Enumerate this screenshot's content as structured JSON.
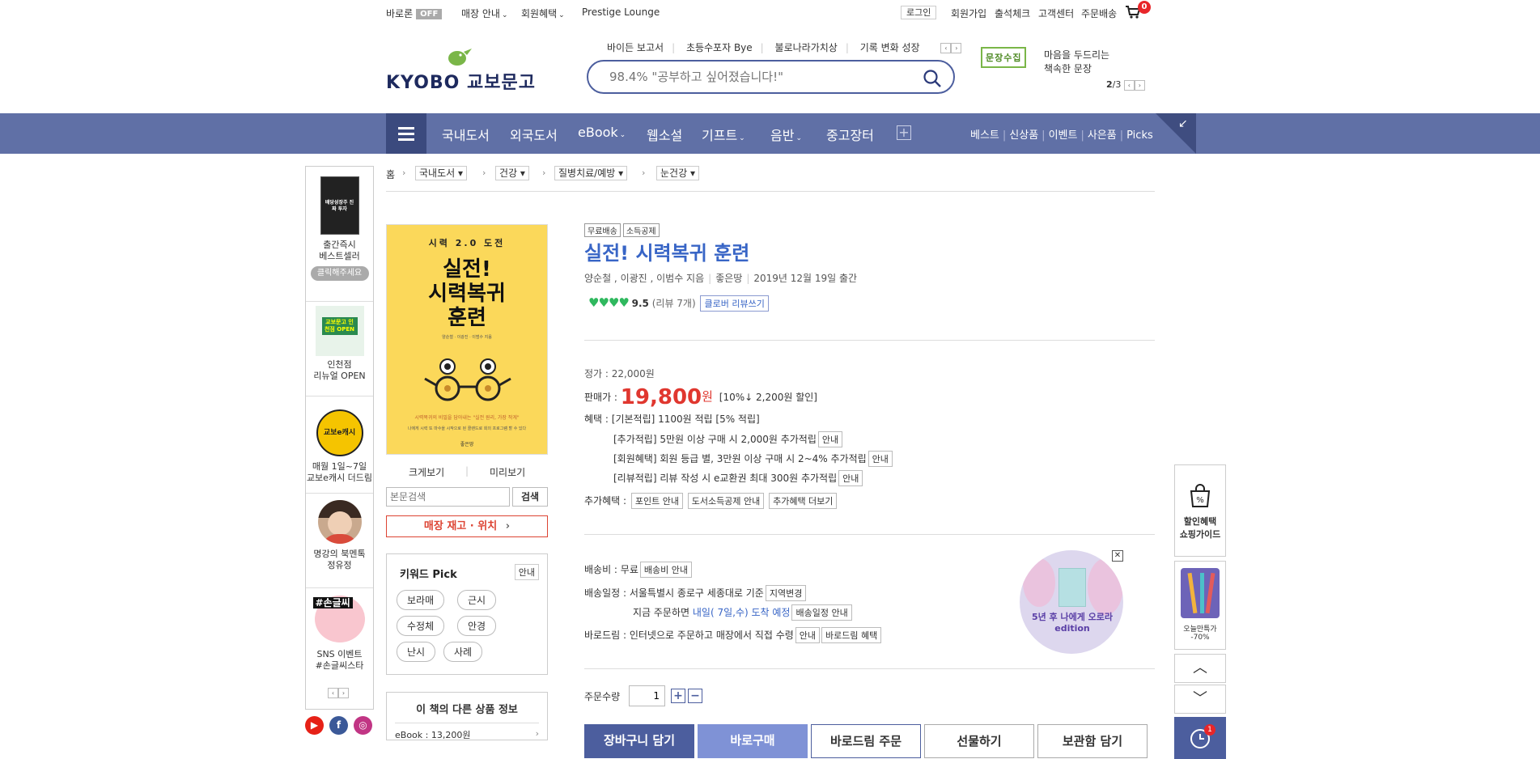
{
  "topbar": {
    "baro_label": "바로론",
    "baro_state": "OFF",
    "store_guide": "매장 안내",
    "member_benefit": "회원혜택",
    "prestige": "Prestige Lounge",
    "login": "로그인",
    "join": "회원가입",
    "attendance": "출석체크",
    "customer_center": "고객센터",
    "order_delivery": "주문배송",
    "cart_count": "0"
  },
  "header": {
    "logo_text": "KYOBO 교보문고",
    "quick_links": [
      "바이든 보고서",
      "초등수포자 Bye",
      "불로나라가치상",
      "기록 변화 성장"
    ],
    "search_placeholder": "98.4% \"공부하고 싶어졌습니다!\"",
    "ad_box": "문장수집",
    "ad_text_1": "마음을 두드리는",
    "ad_text_2": "책속한 문장",
    "ad_page_current": "2",
    "ad_page_total": "/3"
  },
  "nav": {
    "items": [
      "국내도서",
      "외국도서",
      "eBook",
      "웹소설",
      "기프트",
      "음반",
      "중고장터"
    ],
    "right": [
      "베스트",
      "신상품",
      "이벤트",
      "사은품",
      "Picks"
    ]
  },
  "leftrail": {
    "items": [
      {
        "line1": "출간즉시",
        "line2": "베스트셀러",
        "button": "클릭해주세요"
      },
      {
        "line1": "인천점",
        "line2": "리뉴얼 OPEN",
        "img_text": "교보문고 인천점 OPEN"
      },
      {
        "line1": "매월 1일~7일",
        "line2": "교보e캐시 더드림",
        "img_text": "교보e캐시"
      },
      {
        "line1": "명강의 북멘톡",
        "line2": "정유정"
      },
      {
        "line1": "SNS 이벤트",
        "line2": "#손글씨스타",
        "img_text": "#손글씨"
      }
    ],
    "book_thumb_text": "배당성장주 진짜 투자"
  },
  "breadcrumb": {
    "home": "홈",
    "levels": [
      "국내도서",
      "건강",
      "질병치료/예방",
      "눈건강"
    ]
  },
  "cover": {
    "top": "시력 2.0 도전",
    "title_1": "실전!",
    "title_2": "시력복귀",
    "title_3": "훈련",
    "authors": "양순철 · 이광진 · 이범수 지음",
    "slogan": "시력복귀의 비밀을 담아내는 \"실전 원리, 가장 작게\"",
    "desc": "나에게 시력 또 마수을 시작으로 된 콜랜드로 회의 프로그램 할 수 있다",
    "publisher": "좋은땅"
  },
  "left_actions": {
    "zoom": "크게보기",
    "preview": "미리보기",
    "body_search_placeholder": "본문검색",
    "search_btn": "검색",
    "store_stock": "매장 재고 · 위치"
  },
  "keyword": {
    "title": "키워드 Pick",
    "info": "안내",
    "chips": [
      "보라매",
      "근시",
      "수정체",
      "안경",
      "난시",
      "사례"
    ]
  },
  "other_products": {
    "title": "이 책의 다른 상품 정보",
    "ebook": "eBook : 13,200원"
  },
  "product": {
    "tags": [
      "무료배송",
      "소득공제"
    ],
    "title": "실전! 시력복귀 훈련",
    "authors": "양순철 , 이광진 , 이범수 지음",
    "publisher": "좋은땅",
    "pubdate": "2019년 12월 19일 출간",
    "rating": "9.5",
    "rating_stars": 4,
    "review_count": "(리뷰 7개)",
    "review_btn": "클로버 리뷰쓰기",
    "list_price": "정가 : 22,000원",
    "sale_label": "판매가 : ",
    "sale_price": "19,800",
    "sale_unit": "원",
    "discount": "[10%↓ 2,200원 할인]",
    "benefit_label": "혜택 : ",
    "benefit_1": "[기본적립] 1100원 적립 [5% 적립]",
    "benefit_2": "[추가적립] 5만원 이상 구매 시 2,000원 추가적립",
    "benefit_3": "[회원혜택] 회원 등급 별, 3만원 이상 구매 시 2~4% 추가적립",
    "benefit_4": "[리뷰적립] 리뷰 작성 시 e교환권 최대 300원 추가적립",
    "info_btn": "안내",
    "extra_label": "추가혜택 : ",
    "extra_btns": [
      "포인트 안내",
      "도서소득공제 안내",
      "추가혜택 더보기"
    ],
    "shipping_fee": "배송비 : 무료",
    "shipping_fee_btn": "배송비 안내",
    "shipping_schedule": "배송일정 : 서울특별시 종로구 세종대로 기준",
    "region_btn": "지역변경",
    "order_now_prefix": "지금 주문하면",
    "order_now_date": "내일( 7일,수) 도착 예정",
    "schedule_btn": "배송일정 안내",
    "barodrim": "바로드림 : 인터넷으로 주문하고 매장에서 직접 수령",
    "barodrim_info": "안내",
    "barodrim_benefit": "바로드림 혜택",
    "promo_text": "5년 후 나에게 오로라 edition",
    "qty_label": "주문수량",
    "qty_value": "1",
    "actions": [
      "장바구니 담기",
      "바로구매",
      "바로드림 주문",
      "선물하기",
      "보관함 담기"
    ]
  },
  "rightrail": {
    "shopping_guide_1": "할인혜택",
    "shopping_guide_2": "쇼핑가이드",
    "today_1": "오늘만특가",
    "today_2": "-70%",
    "recent_badge": "1"
  },
  "colors": {
    "nav_bg": "#6070a6",
    "brand_dark": "#3b4a7e",
    "title_blue": "#3865c6",
    "price_red": "#e0372f",
    "rating_green": "#2fb85e"
  }
}
